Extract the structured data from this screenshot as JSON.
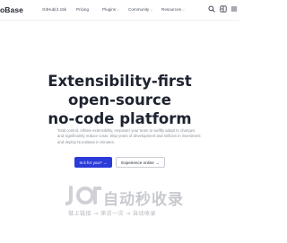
{
  "header": {
    "logo_text": "oBase",
    "nav": {
      "github": "GitHub(4.15k",
      "pricing": "Pricing",
      "plugins": "Plugins",
      "community": "Community",
      "resources": "Resources"
    },
    "icons": [
      "search-icon",
      "theme-toggle-icon",
      "menu-icon"
    ]
  },
  "hero": {
    "title_line1": "Extensibility-first",
    "title_line2": "open-source",
    "title_line3": "no-code platform",
    "description": "Total control, infinite extensibility, empower your team to swiftly adapt to changes and significantly reduce costs. Skip years of development and millions in investment and deploy NocoBase in minutes.",
    "primary_button": "Is it for you? →",
    "secondary_button": "Experience online →"
  },
  "watermark": {
    "title": "自动秒收录",
    "subtitle": "做上链接 → 来访一次 → 自动收录"
  },
  "colors": {
    "accent": "#2b3bd8",
    "text": "#1e2330",
    "muted": "#8a909c",
    "watermark": "#c8cad0"
  }
}
